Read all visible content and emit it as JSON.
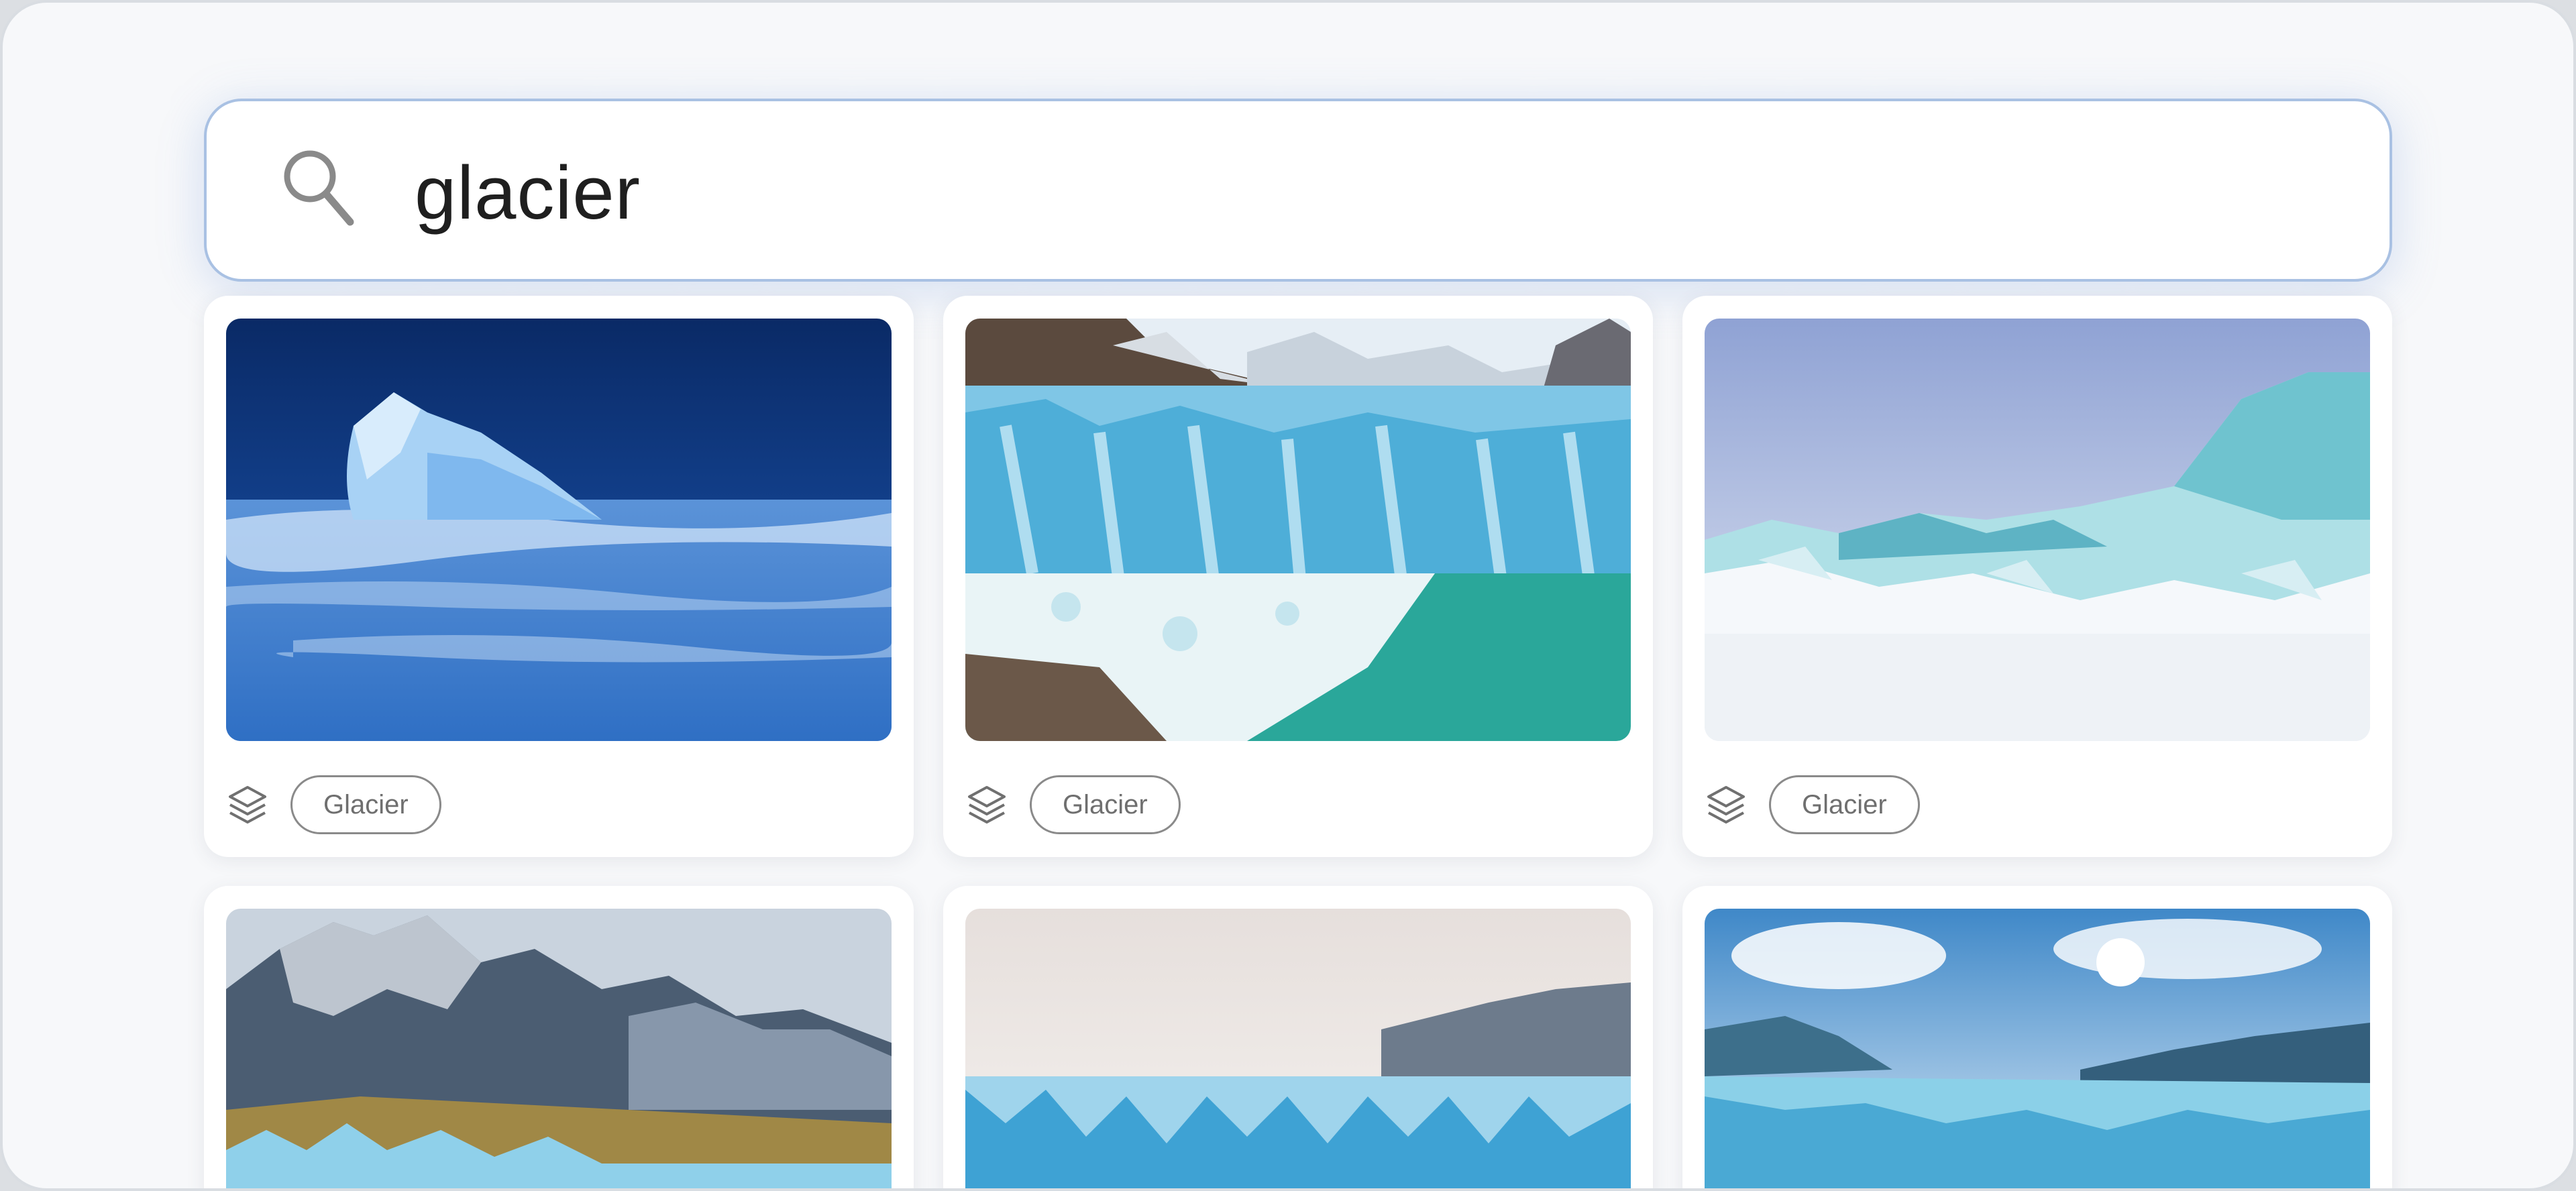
{
  "search": {
    "query": "glacier",
    "icon": "search-icon"
  },
  "results": [
    {
      "tag": "Glacier",
      "icon": "layers-icon"
    },
    {
      "tag": "Glacier",
      "icon": "layers-icon"
    },
    {
      "tag": "Glacier",
      "icon": "layers-icon"
    },
    {
      "tag": "",
      "icon": ""
    },
    {
      "tag": "",
      "icon": ""
    },
    {
      "tag": "",
      "icon": ""
    }
  ],
  "colors": {
    "search_border": "#a9c1e3",
    "tag_border": "#8a8a8a",
    "tag_text": "#6f6f6f",
    "background": "#f7f8fa"
  }
}
